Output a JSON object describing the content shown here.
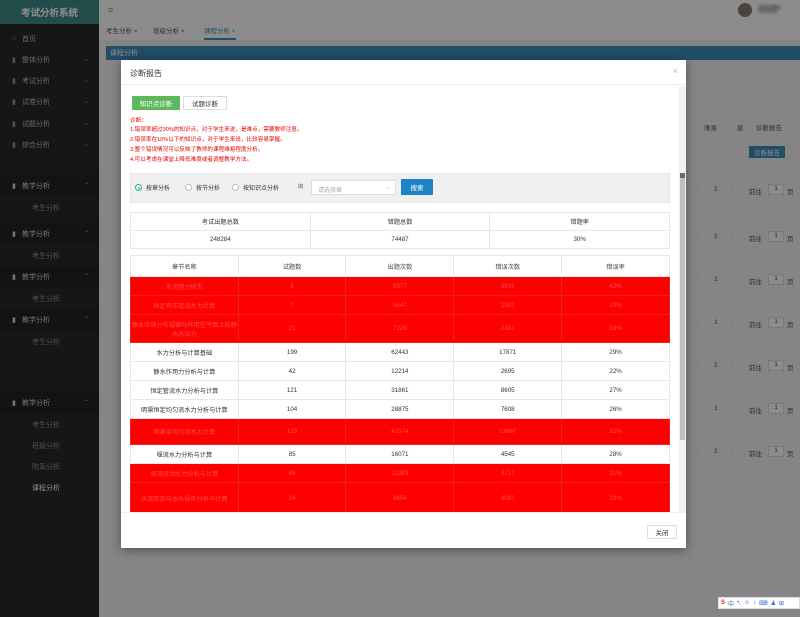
{
  "app": {
    "brand": "考试分析系统",
    "user_suffix": "755"
  },
  "sidebar": {
    "top_items": [
      {
        "label": "首页",
        "icon": "home-icon"
      },
      {
        "label": "整体分析",
        "icon": "chart-icon"
      },
      {
        "label": "考试分析",
        "icon": "chart-icon"
      },
      {
        "label": "试卷分析",
        "icon": "chart-icon"
      },
      {
        "label": "试题分析",
        "icon": "chart-icon"
      },
      {
        "label": "综合分析",
        "icon": "chart-icon"
      },
      {
        "label": "教学分析",
        "icon": "chart-icon"
      }
    ],
    "groups": [
      {
        "label": "教学分析",
        "subs": [
          "考生分析",
          "班级分析"
        ]
      },
      {
        "label": "教学分析",
        "subs": [
          "考生分析"
        ]
      },
      {
        "label": "教学分析",
        "subs": [
          "考生分析"
        ]
      },
      {
        "label": "教学分析",
        "subs": [
          "考生分析"
        ]
      },
      {
        "label": "教学分析",
        "subs": [
          "考生分析",
          "班级分析",
          "院系分析",
          "课程分析"
        ]
      }
    ]
  },
  "tabs": [
    {
      "label": "考生分析 ×"
    },
    {
      "label": "班级分析 ×"
    },
    {
      "label": "课程分析 ×"
    }
  ],
  "background": {
    "bar_title": "课程分析",
    "col_headers": [
      "难易",
      "星",
      "诊断报告"
    ],
    "diag_button": "诊断报告",
    "pager_goto": "前往",
    "pager_page": "1",
    "pager_unit": "页"
  },
  "modal": {
    "title": "诊断报告",
    "close_x": "×",
    "tab_knowledge": "知识点诊断",
    "tab_question": "试题诊断",
    "diag_lines": [
      "诊断：",
      "1.错误率超过30%的知识点，对于学生来说，是难点，需要教师注意。",
      "2.错误率在10%以下的知识点，对于学生来说，比较容易掌握。",
      "3.整个错误情况可以反映了教师的课程难易程度分析。",
      "4.可以考虑在课堂上降低难度或者调整教学方法。"
    ],
    "filter": {
      "radios": [
        "按章分析",
        "按节分析",
        "按知识点分析"
      ],
      "select_placeholder": "请选择章",
      "search_button": "搜索"
    },
    "summary": {
      "headers": [
        "考试出题总数",
        "错题总数",
        "错题率"
      ],
      "values": [
        "248284",
        "74487",
        "30%"
      ]
    },
    "chapter_table": {
      "headers": [
        "章节名称",
        "试题数",
        "出题次数",
        "错误次数",
        "错误率"
      ],
      "rows": [
        {
          "name": "水流阻力损失",
          "count": "8",
          "times": "8577",
          "errors": "3631",
          "rate": "42%",
          "hl": true
        },
        {
          "name": "恒定有压管流水力计算",
          "count": "7",
          "times": "5847",
          "errors": "1952",
          "rate": "33%",
          "hl": true
        },
        {
          "name": "静水压强分布规律与作用在平面上的静水总压力",
          "count": "21",
          "times": "7228",
          "errors": "2381",
          "rate": "33%",
          "hl": true
        },
        {
          "name": "水力分析与计算基础",
          "count": "199",
          "times": "62443",
          "errors": "17871",
          "rate": "29%",
          "hl": false
        },
        {
          "name": "静水作用力分析与计算",
          "count": "42",
          "times": "12214",
          "errors": "2695",
          "rate": "22%",
          "hl": false
        },
        {
          "name": "恒定管流水力分析与计算",
          "count": "121",
          "times": "31861",
          "errors": "8605",
          "rate": "27%",
          "hl": false
        },
        {
          "name": "明渠恒定均匀流水力分析与计算",
          "count": "104",
          "times": "28875",
          "errors": "7608",
          "rate": "26%",
          "hl": false
        },
        {
          "name": "明渠非均匀流水力计算",
          "count": "125",
          "times": "42574",
          "errors": "13687",
          "rate": "32%",
          "hl": true
        },
        {
          "name": "堰流水力分析与计算",
          "count": "85",
          "times": "16071",
          "errors": "4545",
          "rate": "28%",
          "hl": false
        },
        {
          "name": "液流运动水力分析与计算",
          "count": "45",
          "times": "11983",
          "errors": "3717",
          "rate": "31%",
          "hl": true
        },
        {
          "name": "水流形态与水头损失分析与计算",
          "count": "34",
          "times": "9454",
          "errors": "3082",
          "rate": "33%",
          "hl": true
        }
      ]
    },
    "close_button": "关闭"
  },
  "ime": {
    "label": "中"
  }
}
